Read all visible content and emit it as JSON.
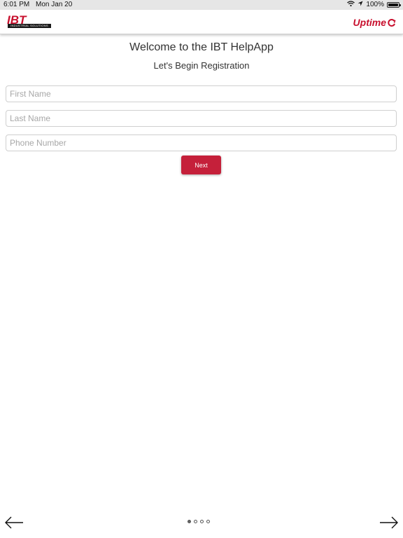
{
  "status_bar": {
    "time": "6:01 PM",
    "date": "Mon Jan 20",
    "battery": "100%",
    "icons": [
      "wifi-icon",
      "location-icon",
      "battery-icon"
    ]
  },
  "header": {
    "left_logo": {
      "text": "IBT",
      "subtitle": "INDUSTRIAL SOLUTIONS"
    },
    "right_logo": {
      "text": "Uptime"
    }
  },
  "main": {
    "title": "Welcome to the IBT HelpApp",
    "subtitle": "Let's Begin Registration",
    "fields": [
      {
        "placeholder": "First Name",
        "value": ""
      },
      {
        "placeholder": "Last Name",
        "value": ""
      },
      {
        "placeholder": "Phone Number",
        "value": ""
      }
    ],
    "next_label": "Next"
  },
  "pager": {
    "total": 4,
    "current": 1
  },
  "colors": {
    "brand_red": "#c8102e",
    "button_red": "#c5203a"
  }
}
